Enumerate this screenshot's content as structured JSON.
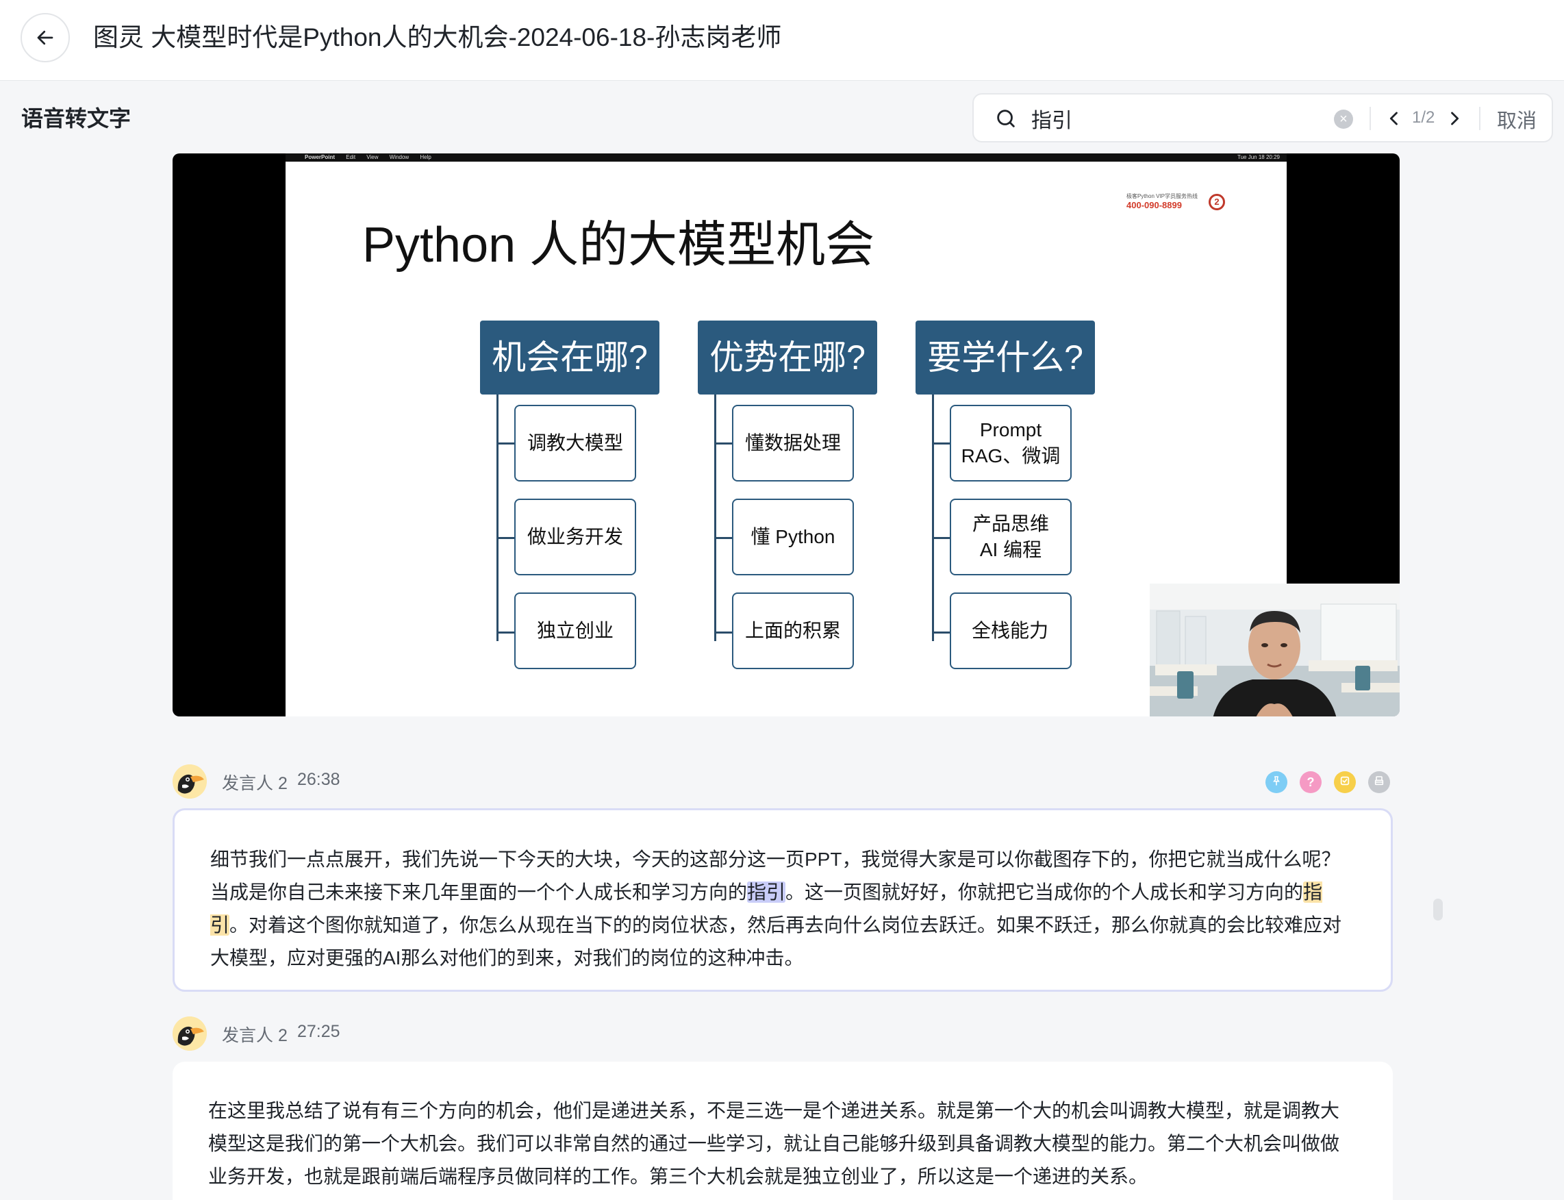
{
  "header": {
    "title": "图灵 大模型时代是Python人的大机会-2024-06-18-孙志岗老师",
    "back_icon": "arrow-left-icon"
  },
  "section": {
    "label": "语音转文字"
  },
  "search": {
    "query": "指引",
    "match_index": "1/2",
    "cancel_label": "取消"
  },
  "video": {
    "menubar": [
      "PowerPoint",
      "Edit",
      "View",
      "Window",
      "Help"
    ],
    "menubar_time": "Tue Jun 18 20:29",
    "slide": {
      "title": "Python 人的大模型机会",
      "hotline_caption": "极客Python VIP学员服务热线",
      "hotline": "400-090-8899",
      "columns": [
        {
          "heading": "机会在哪?",
          "items": [
            [
              "调教大模型"
            ],
            [
              "做业务开发"
            ],
            [
              "独立创业"
            ]
          ]
        },
        {
          "heading": "优势在哪?",
          "items": [
            [
              "懂数据处理"
            ],
            [
              "懂 Python"
            ],
            [
              "上面的积累"
            ]
          ]
        },
        {
          "heading": "要学什么?",
          "items": [
            [
              "Prompt",
              "RAG、微调"
            ],
            [
              "产品思维",
              "AI 编程"
            ],
            [
              "全栈能力"
            ]
          ]
        }
      ]
    }
  },
  "segments": [
    {
      "speaker": "发言人 2",
      "time": "26:38",
      "text_parts": [
        "细节我们一点点展开，我们先说一下今天的大块，今天的这部分这一页PPT，我觉得大家是可以你截图存下的，你把它就当成什么呢？当成是你自己未来接下来几年里面的一个个人成长和学习方向的",
        "指引",
        "。这一页图就好好，你就把它当成你的个人成长和学习方向的",
        "指引",
        "。对着这个图你就知道了，你怎么从现在当下的的岗位状态，然后再去向什么岗位去跃迁。如果不跃迁，那么你就真的会比较难应对大模型，应对更强的AI那么对他们的到来，对我们的岗位的这种冲击。"
      ]
    },
    {
      "speaker": "发言人 2",
      "time": "27:25",
      "text": "在这里我总结了说有有三个方向的机会，他们是递进关系，不是三选一是个递进关系。就是第一个大的机会叫调教大模型，就是调教大模型这是我们的第一个大机会。我们可以非常自然的通过一些学习，就让自己能够升级到具备调教大模型的能力。第二个大机会叫做做业务开发，也就是跟前端后端程序员做同样的工作。第三个大机会就是独立创业了，所以这是一个递进的关系。"
    }
  ],
  "tag_icons": [
    {
      "name": "pin-tag-icon",
      "color": "#7ecdf5"
    },
    {
      "name": "question-tag-icon",
      "color": "#f59ac4"
    },
    {
      "name": "todo-tag-icon",
      "color": "#f7cf4a"
    },
    {
      "name": "archive-tag-icon",
      "color": "#c5c8cd"
    }
  ]
}
